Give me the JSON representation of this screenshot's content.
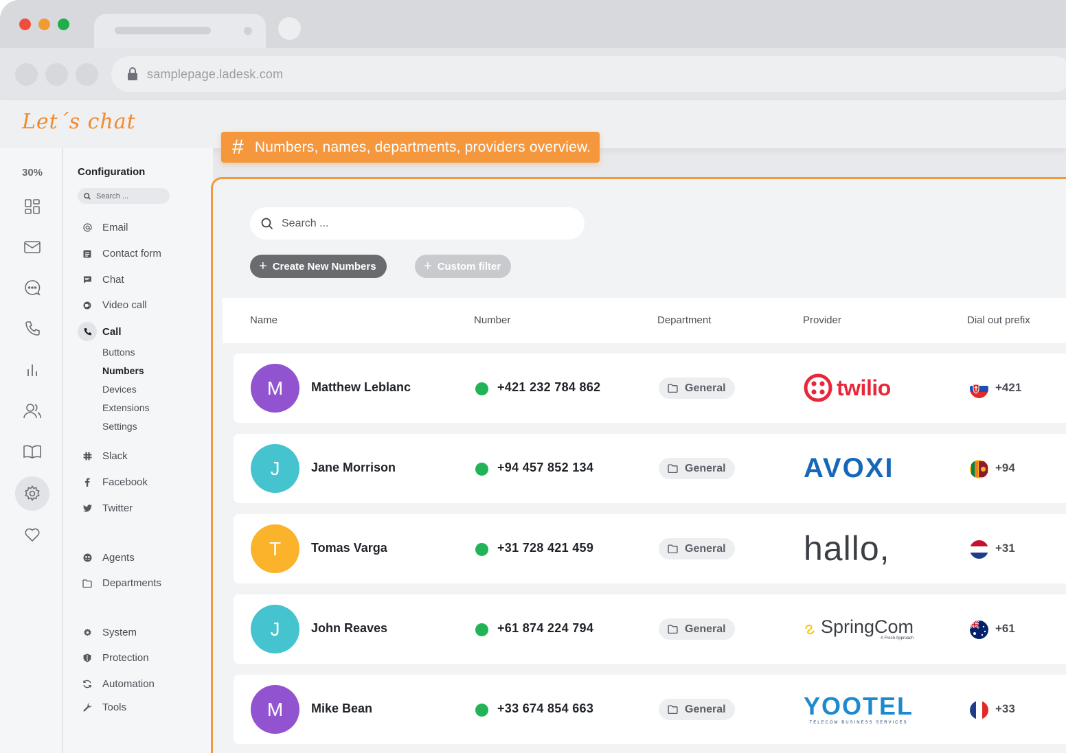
{
  "browser": {
    "url": "samplepage.ladesk.com",
    "traffic_lights": [
      "#f04d3a",
      "#f39a32",
      "#1fae4b"
    ]
  },
  "brand": {
    "text": "Let´s chat",
    "color": "#f28a2e"
  },
  "banner": {
    "hash": "#",
    "text": "Numbers, names, departments, providers overview."
  },
  "rail": {
    "percent": "30%",
    "icons": [
      "dashboard-icon",
      "mail-icon",
      "chat-bubble-icon",
      "phone-icon",
      "reports-icon",
      "users-icon",
      "book-icon",
      "settings-icon",
      "heart-icon"
    ]
  },
  "menu": {
    "title": "Configuration",
    "search_placeholder": "Search ...",
    "items": [
      {
        "label": "Email",
        "icon": "at-icon"
      },
      {
        "label": "Contact form",
        "icon": "form-icon"
      },
      {
        "label": "Chat",
        "icon": "chat-icon"
      },
      {
        "label": "Video call",
        "icon": "video-icon"
      },
      {
        "label": "Call",
        "icon": "phone-icon",
        "active": true
      }
    ],
    "call_sub": [
      {
        "label": "Buttons"
      },
      {
        "label": "Numbers",
        "active": true
      },
      {
        "label": "Devices"
      },
      {
        "label": "Extensions"
      },
      {
        "label": "Settings"
      }
    ],
    "social": [
      {
        "label": "Slack",
        "icon": "slack-icon"
      },
      {
        "label": "Facebook",
        "icon": "facebook-icon"
      },
      {
        "label": "Twitter",
        "icon": "twitter-icon"
      }
    ],
    "people": [
      {
        "label": "Agents",
        "icon": "agents-icon"
      },
      {
        "label": "Departments",
        "icon": "folder-icon"
      }
    ],
    "system": [
      {
        "label": "System",
        "icon": "gear-icon"
      },
      {
        "label": "Protection",
        "icon": "shield-icon"
      },
      {
        "label": "Automation",
        "icon": "automation-icon"
      },
      {
        "label": "Tools",
        "icon": "wrench-icon"
      }
    ]
  },
  "panel": {
    "search_placeholder": "Search ...",
    "create_button": "Create New Numbers",
    "filter_button": "Custom filter",
    "columns": [
      "Name",
      "Number",
      "Department",
      "Provider",
      "Dial out prefix"
    ]
  },
  "rows": [
    {
      "initial": "M",
      "avatar_color": "#9153cf",
      "name": "Matthew Leblanc",
      "number": "+421 232 784 862",
      "department": "General",
      "provider": "twilio",
      "flag": "slovakia-flag",
      "prefix": "+421"
    },
    {
      "initial": "J",
      "avatar_color": "#45c4cf",
      "name": "Jane Morrison",
      "number": "+94 457 852 134",
      "department": "General",
      "provider": "AVOXI",
      "flag": "sri-lanka-flag",
      "prefix": "+94"
    },
    {
      "initial": "T",
      "avatar_color": "#fbb32b",
      "name": "Tomas Varga",
      "number": "+31 728 421 459",
      "department": "General",
      "provider": "hallo,",
      "flag": "netherlands-flag",
      "prefix": "+31"
    },
    {
      "initial": "J",
      "avatar_color": "#45c4cf",
      "name": "John Reaves",
      "number": "+61 874 224 794",
      "department": "General",
      "provider": "SpringCom",
      "provider_tagline": "A Fresh Approach",
      "flag": "australia-flag",
      "prefix": "+61"
    },
    {
      "initial": "M",
      "avatar_color": "#9153cf",
      "name": "Mike Bean",
      "number": "+33 674 854 663",
      "department": "General",
      "provider": "YOOTEL",
      "provider_tagline": "TELECOM BUSINESS SERVICES",
      "flag": "france-flag",
      "prefix": "+33"
    }
  ]
}
